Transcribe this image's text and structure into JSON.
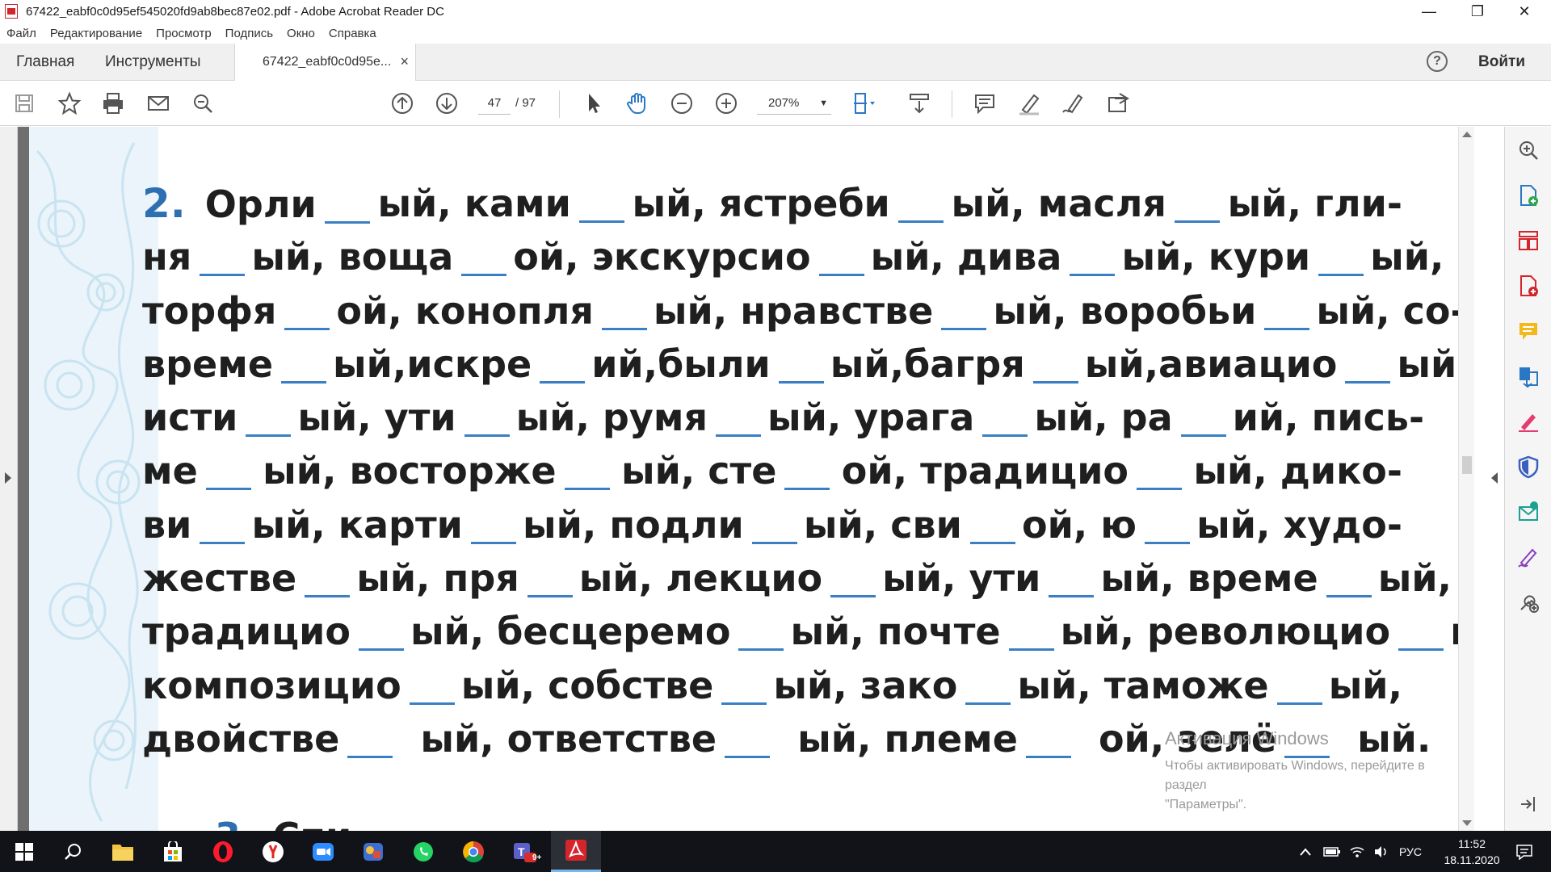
{
  "window": {
    "title": "67422_eabf0c0d95ef545020fd9ab8bec87e02.pdf - Adobe Acrobat Reader DC",
    "minimize": "—",
    "restore": "❐",
    "close": "✕"
  },
  "menu": [
    "Файл",
    "Редактирование",
    "Просмотр",
    "Подпись",
    "Окно",
    "Справка"
  ],
  "tabs": {
    "home": "Главная",
    "tools": "Инструменты",
    "document": "67422_eabf0c0d95e...",
    "document_close": "×",
    "help": "?",
    "signin": "Войти"
  },
  "toolbar": {
    "page_current": "47",
    "page_total": "/ 97",
    "zoom": "207%",
    "icons": [
      "save-icon",
      "bookmark-star-icon",
      "print-icon",
      "email-icon",
      "search-icon",
      "page-up-icon",
      "page-down-icon",
      "select-pointer-icon",
      "hand-pan-icon",
      "zoom-out-icon",
      "zoom-in-icon",
      "fit-page-icon",
      "scroll-mode-icon",
      "comment-icon",
      "highlight-pen-icon",
      "sign-icon",
      "share-icon"
    ]
  },
  "document": {
    "exercise_number": "2.",
    "lines": [
      [
        "Орли",
        "ый, ками",
        "ый, ястреби",
        "ый, масля",
        "ый, гли-"
      ],
      [
        "ня",
        "ый, воща",
        "ой, экскурсио",
        "ый, дива",
        "ый, кури",
        "ый,"
      ],
      [
        "торфя",
        "ой, конопля",
        "ый, нравстве",
        "ый, воробьи",
        "ый, со-"
      ],
      [
        "време",
        "ый,искре",
        "ий,были",
        "ый,багря",
        "ый,авиацио",
        "ый,"
      ],
      [
        "исти",
        "ый, ути",
        "ый, румя",
        "ый, урага",
        "ый, ра",
        "ий, пись-"
      ],
      [
        "ме",
        "ый, восторже",
        "ый, сте",
        "ой, традицио",
        "ый, дико-"
      ],
      [
        "ви",
        "ый, карти",
        "ый, подли",
        "ый, сви",
        "ой, ю",
        "ый, худо-"
      ],
      [
        "жестве",
        "ый, пря",
        "ый, лекцио",
        "ый, ути",
        "ый, време",
        "ый,"
      ],
      [
        "традицио",
        "ый, бесцеремо",
        "ый, почте",
        "ый, революцио",
        "ый,"
      ],
      [
        "композицио",
        "ый, собстве",
        "ый, зако",
        "ый, таможе",
        "ый,"
      ],
      [
        "двойстве",
        "ый, ответстве",
        "ый, племе",
        "ой, зелё",
        "ый."
      ]
    ],
    "next_exercise_number": "3.",
    "next_exercise_fragment": "Спи"
  },
  "watermark": {
    "title": "Активация Windows",
    "text_line1": "Чтобы активировать Windows, перейдите в раздел",
    "text_line2": "\"Параметры\"."
  },
  "right_pane_icons": [
    "zoom-search-icon",
    "create-pdf-icon",
    "organize-pages-icon",
    "export-pdf-icon",
    "comment-tool-icon",
    "combine-files-icon",
    "fill-sign-icon",
    "protect-shield-icon",
    "send-review-icon",
    "edit-pen-icon",
    "more-tools-icon",
    "expand-pane-icon"
  ],
  "taskbar": {
    "apps": [
      "start-windows-icon",
      "search-icon",
      "file-explorer-icon",
      "store-icon",
      "opera-browser-icon",
      "yandex-browser-icon",
      "zoom-video-icon",
      "games-icon",
      "whatsapp-icon",
      "chrome-browser-icon",
      "teams-icon",
      "acrobat-icon"
    ],
    "teams_badge": "9+",
    "language": "РУС",
    "time": "11:52",
    "date": "18.11.2020"
  },
  "colors": {
    "exercise_number": "#2e6fb2",
    "blank_line": "#3a7fc4",
    "acrobat_red": "#d4252c",
    "taskbar_bg": "#111319"
  }
}
